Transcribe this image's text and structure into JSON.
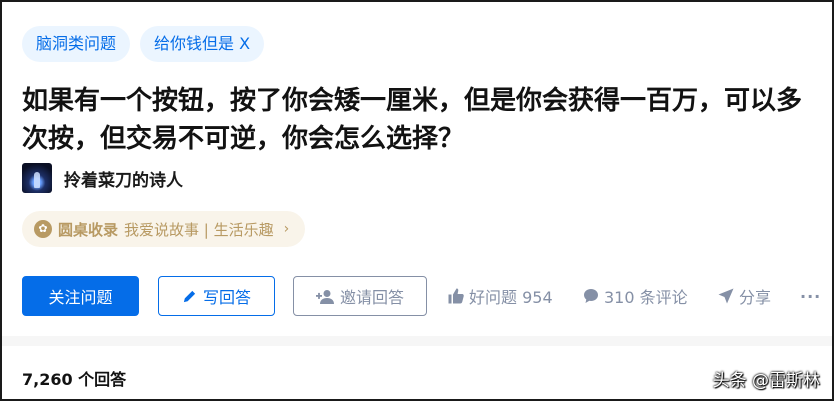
{
  "tags": [
    "脑洞类问题",
    "给你钱但是 X"
  ],
  "question": {
    "title": "如果有一个按钮，按了你会矮一厘米，但是你会获得一百万，可以多次按，但交易不可逆，你会怎么选择？"
  },
  "author": {
    "name": "拎着菜刀的诗人"
  },
  "roundtable": {
    "label": "圆桌收录",
    "text": "我爱说故事 | 生活乐趣",
    "arrow": "›"
  },
  "actions": {
    "follow": "关注问题",
    "answer": "写回答",
    "invite": "邀请回答",
    "good_question": "好问题 954",
    "comments": "310 条评论",
    "share": "分享",
    "more": "···"
  },
  "icons": {
    "pencil": "pencil-icon",
    "invite": "add-user-icon",
    "thumb": "thumbs-up-icon",
    "comment": "comment-bubble-icon",
    "share": "paper-plane-icon",
    "more": "more-dots-icon"
  },
  "answers_count": "7,260 个回答",
  "watermark": "头条 @雷斯林",
  "colors": {
    "brand": "#056de8",
    "tag_bg": "#ebf5ff",
    "muted": "#8590a6",
    "gold": "#b89a63"
  }
}
